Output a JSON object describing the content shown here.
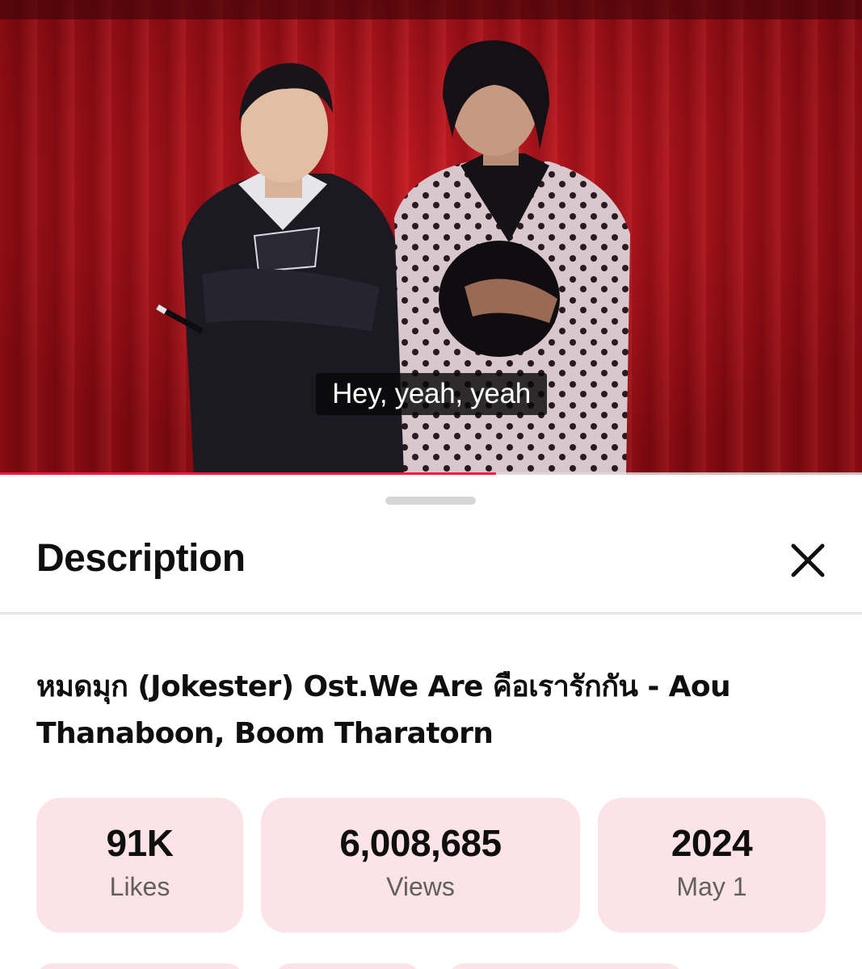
{
  "video": {
    "caption": "Hey, yeah, yeah",
    "progress_fraction": 0.575,
    "progress_color": "#ff1744"
  },
  "description_sheet": {
    "title": "Description",
    "close_icon": "close-icon",
    "video_title": "หมดมุก (Jokester) Ost.We Are คือเรารักกัน - Aou Thanaboon, Boom Tharatorn",
    "stats": {
      "likes": {
        "value": "91K",
        "label": "Likes"
      },
      "views": {
        "value": "6,008,685",
        "label": "Views"
      },
      "date": {
        "value": "2024",
        "label": "May 1"
      }
    },
    "stat_background": "#fbe3e8"
  }
}
